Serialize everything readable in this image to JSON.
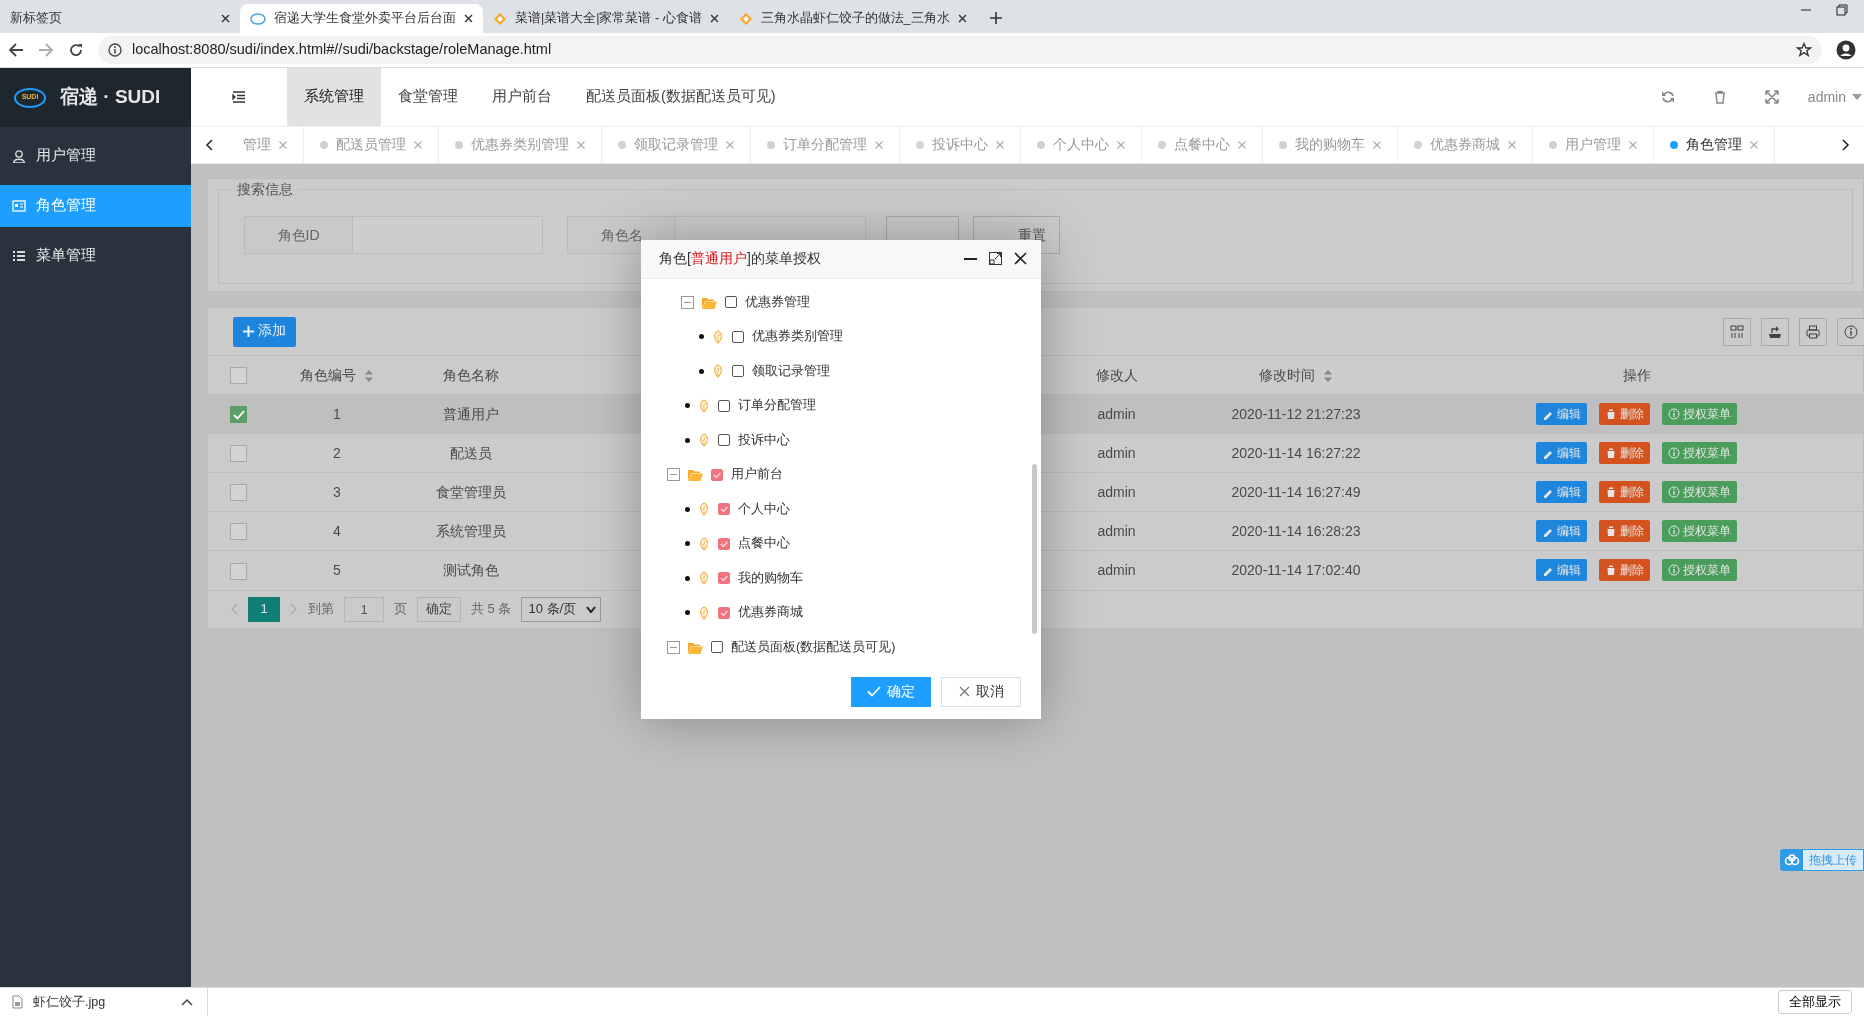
{
  "browser": {
    "tabs": [
      {
        "title": "新标签页",
        "selected": false
      },
      {
        "title": "宿递大学生食堂外卖平台后台面",
        "selected": true
      },
      {
        "title": "菜谱|菜谱大全|家常菜谱 - 心食谱",
        "selected": false
      },
      {
        "title": "三角水晶虾仁饺子的做法_三角水",
        "selected": false
      }
    ],
    "address": "localhost:8080/sudi/index.html#//sudi/backstage/roleManage.html"
  },
  "app": {
    "logo_text": "SUDI",
    "brand": "宿递 · SUDI"
  },
  "top_nav": [
    {
      "label": "系统管理",
      "selected": true
    },
    {
      "label": "食堂管理",
      "selected": false
    },
    {
      "label": "用户前台",
      "selected": false
    },
    {
      "label": "配送员面板(数据配送员可见)",
      "selected": false
    }
  ],
  "user": "admin",
  "sidebar": [
    {
      "label": "用户管理",
      "selected": false
    },
    {
      "label": "角色管理",
      "selected": true
    },
    {
      "label": "菜单管理",
      "selected": false
    }
  ],
  "page_tabs": [
    {
      "label": "管理",
      "selected": false
    },
    {
      "label": "配送员管理",
      "selected": false
    },
    {
      "label": "优惠券类别管理",
      "selected": false
    },
    {
      "label": "领取记录管理",
      "selected": false
    },
    {
      "label": "订单分配管理",
      "selected": false
    },
    {
      "label": "投诉中心",
      "selected": false
    },
    {
      "label": "个人中心",
      "selected": false
    },
    {
      "label": "点餐中心",
      "selected": false
    },
    {
      "label": "我的购物车",
      "selected": false
    },
    {
      "label": "优惠券商城",
      "selected": false
    },
    {
      "label": "用户管理",
      "selected": false
    },
    {
      "label": "角色管理",
      "selected": true
    }
  ],
  "search": {
    "title": "搜索信息",
    "fields": [
      {
        "label": "角色ID"
      },
      {
        "label": "角色名"
      }
    ],
    "reset_button": "重置"
  },
  "toolbar": {
    "add_button": "添加"
  },
  "table": {
    "header_checked": false,
    "columns": [
      {
        "label": "角色编号",
        "sortable": true
      },
      {
        "label": "角色名称",
        "sortable": false
      },
      {
        "label": "修改人",
        "sortable": false
      },
      {
        "label": "修改时间",
        "sortable": true
      },
      {
        "label": "操作",
        "sortable": false
      }
    ],
    "rows": [
      {
        "selected": true,
        "id": "1",
        "name": "普通用户",
        "modifier": "admin",
        "time": "2020-11-12 21:27:23",
        "actions": [
          "编辑",
          "删除",
          "授权菜单"
        ]
      },
      {
        "selected": false,
        "id": "2",
        "name": "配送员",
        "modifier": "admin",
        "time": "2020-11-14 16:27:22",
        "actions": [
          "编辑",
          "删除",
          "授权菜单"
        ]
      },
      {
        "selected": false,
        "id": "3",
        "name": "食堂管理员",
        "modifier": "admin",
        "time": "2020-11-14 16:27:49",
        "actions": [
          "编辑",
          "删除",
          "授权菜单"
        ]
      },
      {
        "selected": false,
        "id": "4",
        "name": "系统管理员",
        "modifier": "admin",
        "time": "2020-11-14 16:28:23",
        "actions": [
          "编辑",
          "删除",
          "授权菜单"
        ]
      },
      {
        "selected": false,
        "id": "5",
        "name": "测试角色",
        "modifier": "admin",
        "time": "2020-11-14 17:02:40",
        "actions": [
          "编辑",
          "删除",
          "授权菜单"
        ]
      }
    ]
  },
  "pagination": {
    "pages": [
      {
        "label": "1",
        "selected": true
      }
    ],
    "goto_label": "到第",
    "goto_value": "1",
    "page_unit": "页",
    "confirm": "确定",
    "total": "共 5 条",
    "page_size": "10 条/页"
  },
  "modal": {
    "title_prefix": "角色[",
    "title_role": "普通用户",
    "title_suffix": "]的菜单授权",
    "tree": [
      {
        "kind": "scrolled-parent",
        "children": [
          {
            "kind": "folder",
            "label": "优惠券管理",
            "checked": false,
            "expanded": true,
            "children": [
              {
                "kind": "leaf",
                "label": "优惠券类别管理",
                "checked": false
              },
              {
                "kind": "leaf",
                "label": "领取记录管理",
                "checked": false
              }
            ]
          },
          {
            "kind": "leaf",
            "label": "订单分配管理",
            "checked": false
          },
          {
            "kind": "leaf",
            "label": "投诉中心",
            "checked": false
          }
        ]
      },
      {
        "kind": "folder",
        "label": "用户前台",
        "checked": true,
        "expanded": true,
        "children": [
          {
            "kind": "leaf",
            "label": "个人中心",
            "checked": true
          },
          {
            "kind": "leaf",
            "label": "点餐中心",
            "checked": true
          },
          {
            "kind": "leaf",
            "label": "我的购物车",
            "checked": true
          },
          {
            "kind": "leaf",
            "label": "优惠券商城",
            "checked": true
          }
        ]
      },
      {
        "kind": "folder",
        "label": "配送员面板(数据配送员可见)",
        "checked": false,
        "expanded": true
      }
    ],
    "buttons": [
      {
        "label": "确定",
        "kind": "primary"
      },
      {
        "label": "取消",
        "kind": "secondary"
      }
    ]
  },
  "upload_widget": "拖拽上传",
  "download_bar": {
    "file": "虾仁饺子.jpg",
    "show_all": "全部显示"
  }
}
